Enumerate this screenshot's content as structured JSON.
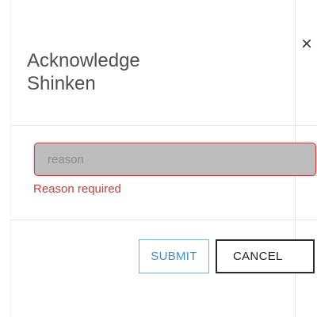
{
  "dialog": {
    "title": "Acknowledge Shinken",
    "close_symbol": "×"
  },
  "form": {
    "reason_placeholder": "reason",
    "reason_value": "",
    "reason_error": "Reason required"
  },
  "footer": {
    "submit_label": "SUBMIT",
    "cancel_label": "CANCEL"
  },
  "colors": {
    "error": "#c8403f",
    "primary_outline": "#6fb3e0",
    "input_background": "#bdbdbd"
  },
  "icons": {
    "close": "close-icon"
  }
}
